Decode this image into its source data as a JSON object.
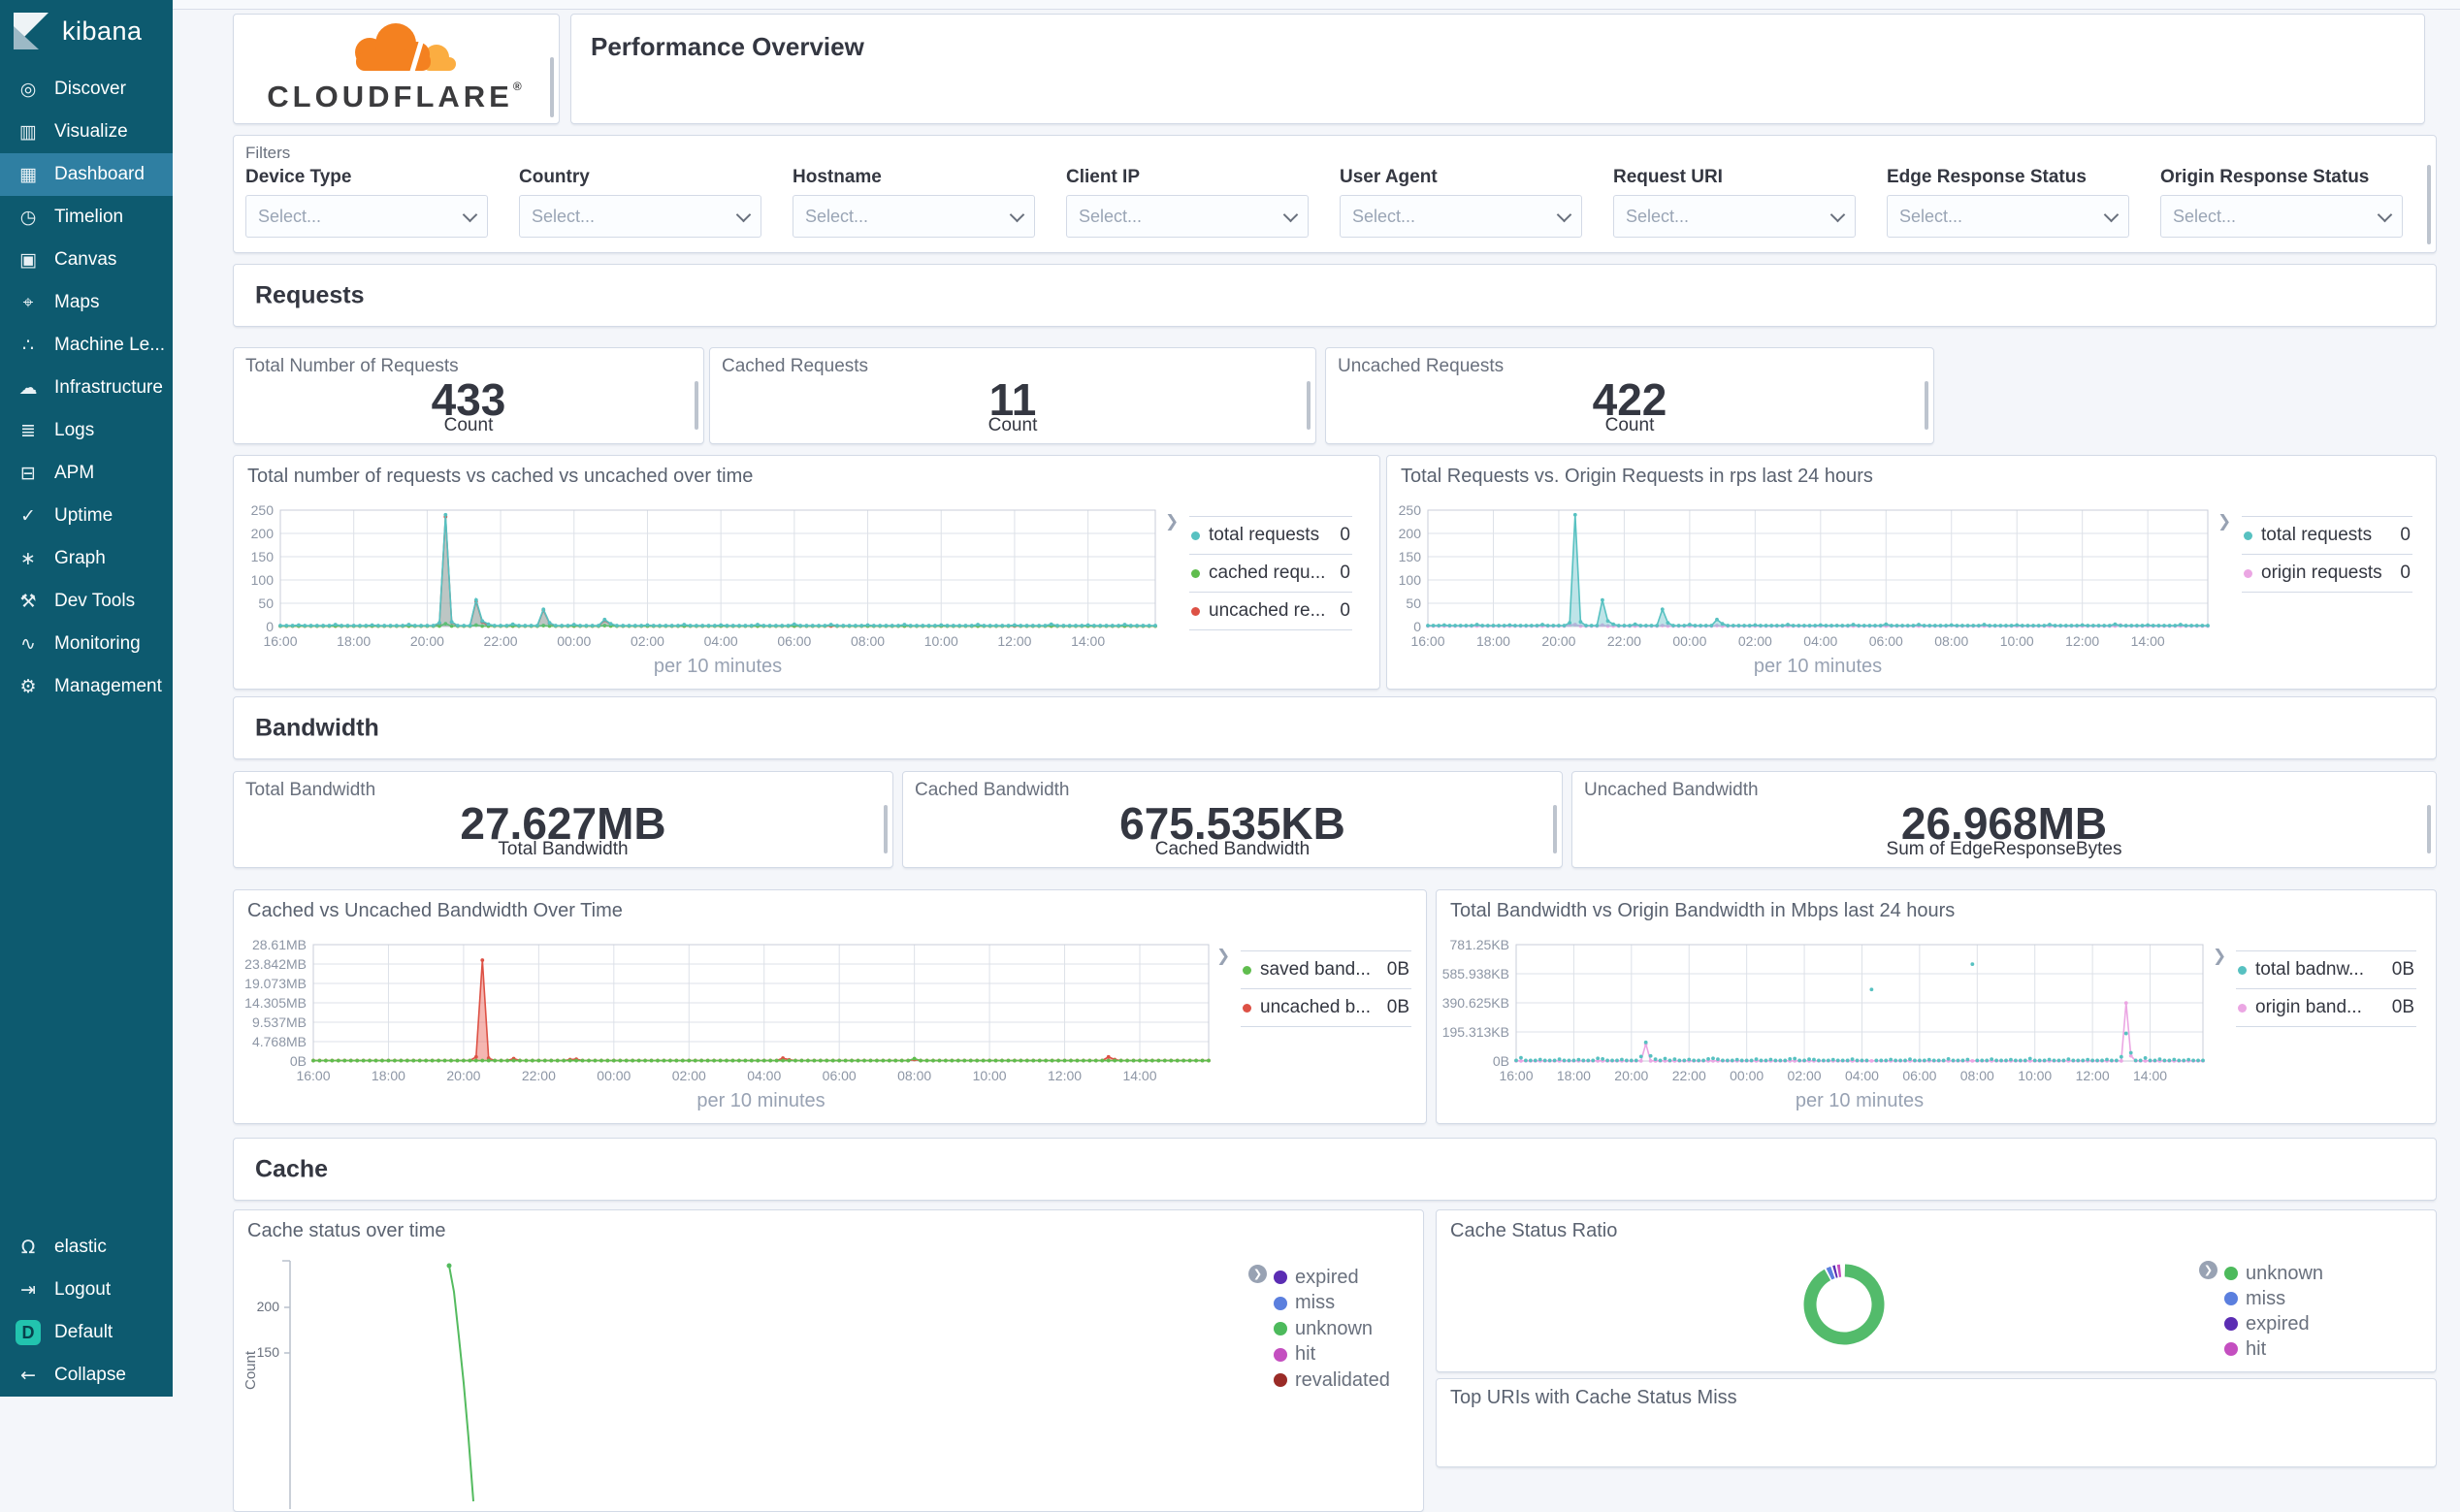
{
  "sidebar": {
    "logo": "kibana",
    "items": [
      {
        "label": "Discover",
        "icon": "◎",
        "icon_name": "compass-icon",
        "active": false
      },
      {
        "label": "Visualize",
        "icon": "▥",
        "icon_name": "visualize-icon",
        "active": false
      },
      {
        "label": "Dashboard",
        "icon": "▦",
        "icon_name": "dashboard-grid-icon",
        "active": true
      },
      {
        "label": "Timelion",
        "icon": "◷",
        "icon_name": "timelion-clock-icon",
        "active": false
      },
      {
        "label": "Canvas",
        "icon": "▣",
        "icon_name": "canvas-icon",
        "active": false
      },
      {
        "label": "Maps",
        "icon": "⌖",
        "icon_name": "map-pin-icon",
        "active": false
      },
      {
        "label": "Machine Le...",
        "icon": "∴",
        "icon_name": "machine-learning-icon",
        "active": false
      },
      {
        "label": "Infrastructure",
        "icon": "☁",
        "icon_name": "cloud-icon",
        "active": false
      },
      {
        "label": "Logs",
        "icon": "≣",
        "icon_name": "logs-icon",
        "active": false
      },
      {
        "label": "APM",
        "icon": "⊟",
        "icon_name": "apm-icon",
        "active": false
      },
      {
        "label": "Uptime",
        "icon": "✓",
        "icon_name": "uptime-check-icon",
        "active": false
      },
      {
        "label": "Graph",
        "icon": "∗",
        "icon_name": "graph-icon",
        "active": false
      },
      {
        "label": "Dev Tools",
        "icon": "⚒",
        "icon_name": "wrench-icon",
        "active": false
      },
      {
        "label": "Monitoring",
        "icon": "∿",
        "icon_name": "heartbeat-icon",
        "active": false
      },
      {
        "label": "Management",
        "icon": "⚙",
        "icon_name": "gear-icon",
        "active": false
      }
    ],
    "footer": [
      {
        "label": "elastic",
        "icon": "Ω",
        "icon_name": "user-icon"
      },
      {
        "label": "Logout",
        "icon": "⇥",
        "icon_name": "logout-icon"
      },
      {
        "label": "Default",
        "badge": "D",
        "icon_name": "space-default-badge"
      },
      {
        "label": "Collapse",
        "icon": "←",
        "icon_name": "collapse-arrow-icon"
      }
    ]
  },
  "header": {
    "title": "Performance Overview",
    "logo_text": "CLOUDFLARE",
    "logo_reg": "®"
  },
  "filters": {
    "title": "Filters",
    "placeholder": "Select...",
    "fields": [
      "Device Type",
      "Country",
      "Hostname",
      "Client IP",
      "User Agent",
      "Request URI",
      "Edge Response Status",
      "Origin Response Status"
    ]
  },
  "sections": {
    "requests": "Requests",
    "bandwidth": "Bandwidth",
    "cache": "Cache"
  },
  "metrics": {
    "requests": [
      {
        "title": "Total Number of Requests",
        "value": "433",
        "sub": "Count"
      },
      {
        "title": "Cached Requests",
        "value": "11",
        "sub": "Count"
      },
      {
        "title": "Uncached Requests",
        "value": "422",
        "sub": "Count"
      }
    ],
    "bandwidth": [
      {
        "title": "Total Bandwidth",
        "value": "27.627MB",
        "sub": "Total Bandwidth"
      },
      {
        "title": "Cached Bandwidth",
        "value": "675.535KB",
        "sub": "Cached Bandwidth"
      },
      {
        "title": "Uncached Bandwidth",
        "value": "26.968MB",
        "sub": "Sum of EdgeResponseBytes"
      }
    ]
  },
  "colors": {
    "teal": "#57c1c1",
    "green": "#60bd4e",
    "red": "#dd5145",
    "pink": "#eba6e3",
    "legend_purple": "#5b2db3",
    "legend_blue": "#5b7fde",
    "legend_green": "#4dba5c",
    "legend_magenta": "#c44fc0",
    "legend_darkred": "#9a2b27",
    "sidebar_bg": "#0d5a6f",
    "sidebar_active": "#2f7fa2",
    "badge_teal": "#22c3ae",
    "cloudflare_orange": "#f48120",
    "cloudflare_light_orange": "#fbad41"
  },
  "chart_data": [
    {
      "id": "chartA",
      "type": "line",
      "title": "Total number of requests vs cached vs uncached over time",
      "xlabel": "per 10 minutes",
      "x_ticks": [
        "16:00",
        "18:00",
        "20:00",
        "22:00",
        "00:00",
        "02:00",
        "04:00",
        "06:00",
        "08:00",
        "10:00",
        "12:00",
        "14:00"
      ],
      "n": 144,
      "y_max": 250,
      "y_ticks": [
        {
          "v": 0,
          "label": "0"
        },
        {
          "v": 50,
          "label": "50"
        },
        {
          "v": 100,
          "label": "100"
        },
        {
          "v": 150,
          "label": "150"
        },
        {
          "v": 200,
          "label": "200"
        },
        {
          "v": 250,
          "label": "250"
        }
      ],
      "series": [
        {
          "name": "uncached requests",
          "color": "#dd5145",
          "fill": "rgba(221,81,69,0.30)",
          "baseline": 1,
          "points": {
            "26": 6,
            "27": 236,
            "28": 9,
            "32": 54,
            "33": 10,
            "43": 35,
            "44": 7,
            "53": 13,
            "54": 5
          }
        },
        {
          "name": "cached requests",
          "color": "#60bd4e",
          "baseline": 1,
          "points": {
            "27": 6,
            "32": 3,
            "43": 2,
            "53": 2,
            "90": 3,
            "120": 2
          }
        },
        {
          "name": "total requests",
          "color": "#57c1c1",
          "fill": "rgba(87,193,193,0.35)",
          "baseline": 2,
          "points": {
            "3": 3,
            "9": 4,
            "15": 3,
            "21": 4,
            "26": 8,
            "27": 240,
            "28": 10,
            "32": 57,
            "33": 12,
            "34": 5,
            "38": 5,
            "43": 37,
            "44": 8,
            "48": 4,
            "53": 15,
            "54": 6,
            "60": 3,
            "66": 4,
            "72": 3,
            "78": 4,
            "84": 5,
            "90": 4,
            "96": 3,
            "102": 4,
            "108": 3,
            "114": 4,
            "120": 3,
            "126": 5,
            "132": 3,
            "138": 4
          }
        }
      ],
      "legend": [
        {
          "label": "total requests",
          "value": "0",
          "color": "#57c1c1"
        },
        {
          "label": "cached requ...",
          "value": "0",
          "color": "#60bd4e"
        },
        {
          "label": "uncached re...",
          "value": "0",
          "color": "#dd5145"
        }
      ]
    },
    {
      "id": "chartB",
      "type": "line",
      "title": "Total Requests vs. Origin Requests in rps last 24 hours",
      "xlabel": "per 10 minutes",
      "x_ticks": [
        "16:00",
        "18:00",
        "20:00",
        "22:00",
        "00:00",
        "02:00",
        "04:00",
        "06:00",
        "08:00",
        "10:00",
        "12:00",
        "14:00"
      ],
      "n": 144,
      "y_max": 250,
      "y_ticks": [
        {
          "v": 0,
          "label": "0"
        },
        {
          "v": 50,
          "label": "50"
        },
        {
          "v": 100,
          "label": "100"
        },
        {
          "v": 150,
          "label": "150"
        },
        {
          "v": 200,
          "label": "200"
        },
        {
          "v": 250,
          "label": "250"
        }
      ],
      "series": [
        {
          "name": "origin requests",
          "color": "#eba6e3",
          "baseline": 1,
          "points": {
            "26": 3,
            "27": 4,
            "32": 3,
            "43": 2,
            "53": 2,
            "75": 2,
            "96": 2,
            "127": 3
          }
        },
        {
          "name": "total requests",
          "color": "#57c1c1",
          "fill": "rgba(110,195,205,0.45)",
          "baseline": 2,
          "points": {
            "3": 3,
            "9": 4,
            "15": 3,
            "21": 4,
            "26": 8,
            "27": 240,
            "28": 10,
            "32": 57,
            "33": 12,
            "34": 5,
            "38": 5,
            "43": 37,
            "44": 8,
            "48": 4,
            "53": 15,
            "54": 6,
            "60": 3,
            "66": 4,
            "72": 3,
            "78": 4,
            "84": 5,
            "90": 4,
            "96": 3,
            "102": 4,
            "108": 3,
            "114": 4,
            "120": 3,
            "126": 5,
            "132": 3,
            "138": 4
          }
        }
      ],
      "legend": [
        {
          "label": "total requests",
          "value": "0",
          "color": "#57c1c1"
        },
        {
          "label": "origin requests",
          "value": "0",
          "color": "#eba6e3"
        }
      ]
    },
    {
      "id": "chartC",
      "type": "line",
      "title": "Cached vs Uncached Bandwidth Over Time",
      "xlabel": "per 10 minutes",
      "x_ticks": [
        "16:00",
        "18:00",
        "20:00",
        "22:00",
        "00:00",
        "02:00",
        "04:00",
        "06:00",
        "08:00",
        "10:00",
        "12:00",
        "14:00"
      ],
      "n": 144,
      "y_max": 28.61,
      "y_ticks": [
        {
          "v": 0,
          "label": "0B"
        },
        {
          "v": 4.768,
          "label": "4.768MB"
        },
        {
          "v": 9.537,
          "label": "9.537MB"
        },
        {
          "v": 14.305,
          "label": "14.305MB"
        },
        {
          "v": 19.073,
          "label": "19.073MB"
        },
        {
          "v": 23.842,
          "label": "23.842MB"
        },
        {
          "v": 28.61,
          "label": "28.61MB"
        }
      ],
      "series": [
        {
          "name": "uncached bandwidth",
          "color": "#dd5145",
          "fill": "rgba(235,110,100,0.5)",
          "baseline": 0.12,
          "points": {
            "26": 1.0,
            "27": 24.8,
            "28": 0.7,
            "32": 0.6,
            "41": 0.35,
            "42": 0.45,
            "75": 0.7,
            "76": 0.3,
            "96": 0.35,
            "127": 1.0,
            "128": 0.35
          }
        },
        {
          "name": "saved bandwidth",
          "color": "#60bd4e",
          "baseline": 0.1,
          "points": {
            "96": 0.6
          }
        }
      ],
      "legend": [
        {
          "label": "saved band...",
          "value": "0B",
          "color": "#60bd4e"
        },
        {
          "label": "uncached b...",
          "value": "0B",
          "color": "#dd5145"
        }
      ]
    },
    {
      "id": "chartD",
      "type": "line",
      "title": "Total Bandwidth vs Origin Bandwidth in Mbps last 24 hours",
      "xlabel": "per 10 minutes",
      "x_ticks": [
        "16:00",
        "18:00",
        "20:00",
        "22:00",
        "00:00",
        "02:00",
        "04:00",
        "06:00",
        "08:00",
        "10:00",
        "12:00",
        "14:00"
      ],
      "n": 144,
      "y_max": 781.25,
      "y_ticks": [
        {
          "v": 0,
          "label": "0B"
        },
        {
          "v": 195.313,
          "label": "195.313KB"
        },
        {
          "v": 390.625,
          "label": "390.625KB"
        },
        {
          "v": 585.938,
          "label": "585.938KB"
        },
        {
          "v": 781.25,
          "label": "781.25KB"
        }
      ],
      "series": [
        {
          "name": "origin bandwidth",
          "color": "#eba6e3",
          "baseline": 1,
          "points": {
            "27": 115,
            "127": 390,
            "128": 35
          }
        },
        {
          "name": "total bandwidth",
          "color": "#57c1c1",
          "line": false,
          "baseline": 4,
          "points": {
            "1": 22,
            "5": 10,
            "9": 12,
            "13": 9,
            "17": 18,
            "18": 14,
            "22": 10,
            "26": 30,
            "27": 125,
            "28": 34,
            "29": 12,
            "31": 16,
            "33": 12,
            "36": 10,
            "40": 14,
            "41": 18,
            "42": 12,
            "46": 9,
            "50": 12,
            "53": 10,
            "57": 14,
            "58": 16,
            "61": 12,
            "62": 10,
            "66": 9,
            "70": 12,
            "74": 480,
            "78": 10,
            "82": 12,
            "86": 9,
            "90": 14,
            "94": 10,
            "95": 650,
            "99": 12,
            "103": 9,
            "107": 16,
            "111": 10,
            "115": 12,
            "119": 9,
            "123": 10,
            "126": 28,
            "127": 185,
            "128": 55,
            "131": 20,
            "134": 12,
            "137": 10,
            "140": 9
          }
        }
      ],
      "legend": [
        {
          "label": "total badnw...",
          "value": "0B",
          "color": "#57c1c1"
        },
        {
          "label": "origin band...",
          "value": "0B",
          "color": "#eba6e3"
        }
      ]
    },
    {
      "id": "chartE",
      "type": "line",
      "title": "Cache status over time",
      "ylabel": "Count",
      "y_ticks_visible": [
        "200",
        "150"
      ],
      "note_visible": "partially cut off at bottom of viewport; green 'unknown' spike ~235 descending",
      "line_color": "#54bb5f",
      "line_points": [
        [
          222,
          57
        ],
        [
          227,
          84
        ],
        [
          232,
          130
        ],
        [
          237,
          178
        ],
        [
          242,
          235
        ],
        [
          247,
          300
        ]
      ],
      "legend": [
        {
          "label": "expired",
          "color": "#5b2db3"
        },
        {
          "label": "miss",
          "color": "#5b7fde"
        },
        {
          "label": "unknown",
          "color": "#4dba5c"
        },
        {
          "label": "hit",
          "color": "#c44fc0"
        },
        {
          "label": "revalidated",
          "color": "#9a2b27"
        }
      ]
    },
    {
      "id": "chartF",
      "type": "pie",
      "title": "Cache Status Ratio",
      "slices": [
        {
          "label": "unknown",
          "frac": 0.923,
          "color": "#53bb6b"
        },
        {
          "label": "miss",
          "frac": 0.027,
          "color": "#5b7fde"
        },
        {
          "label": "expired",
          "frac": 0.018,
          "color": "#5b2db3"
        },
        {
          "label": "hit",
          "frac": 0.02,
          "color": "#c44fc0"
        }
      ],
      "legend": [
        {
          "label": "unknown",
          "color": "#4dba5c"
        },
        {
          "label": "miss",
          "color": "#5b7fde"
        },
        {
          "label": "expired",
          "color": "#5b2db3"
        },
        {
          "label": "hit",
          "color": "#c44fc0"
        }
      ]
    },
    {
      "id": "topuris",
      "type": "unknown",
      "title": "Top URIs with Cache Status Miss",
      "note_visible": "title only, panel cut off at bottom of viewport"
    }
  ]
}
